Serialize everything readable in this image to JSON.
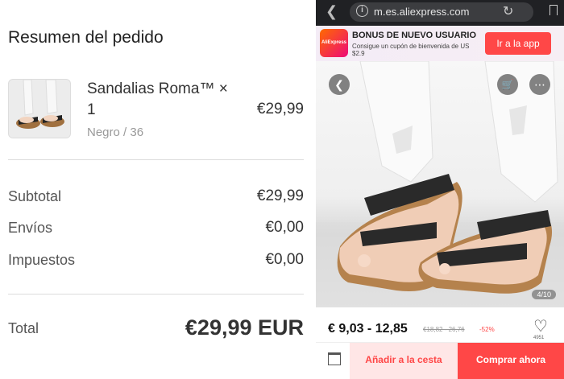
{
  "order_summary": {
    "title": "Resumen del pedido",
    "product": {
      "name": "Sandalias Roma™ × 1",
      "variant": "Negro / 36",
      "price": "€29,99"
    },
    "rows": [
      {
        "label": "Subtotal",
        "value": "€29,99"
      },
      {
        "label": "Envíos",
        "value": "€0,00"
      },
      {
        "label": "Impuestos",
        "value": "€0,00"
      }
    ],
    "total_label": "Total",
    "total_value": "€29,99 EUR"
  },
  "browser": {
    "url": "m.es.aliexpress.com"
  },
  "promo": {
    "logo_text": "AliExpress",
    "title": "BONUS DE NUEVO USUARIO",
    "subtitle": "Consigue un cupón de bienvenida de US $2.9",
    "button": "Ir a la app"
  },
  "product_page": {
    "image_counter": "4/10",
    "price_range": "€ 9,03 - 12,85",
    "price_old": "€18,82 - 26,76",
    "discount": "-52%",
    "wish_count": "4951",
    "add_to_cart": "Añadir a la cesta",
    "buy_now": "Comprar ahora"
  },
  "colors": {
    "accent": "#ff4747",
    "cart_bg": "#ffe6e6",
    "url_bar": "#202124"
  },
  "icons": [
    "back-icon",
    "info-icon",
    "reload-icon",
    "bookmark-icon",
    "photo-back-icon",
    "cart-icon",
    "more-icon",
    "heart-icon",
    "store-icon"
  ]
}
